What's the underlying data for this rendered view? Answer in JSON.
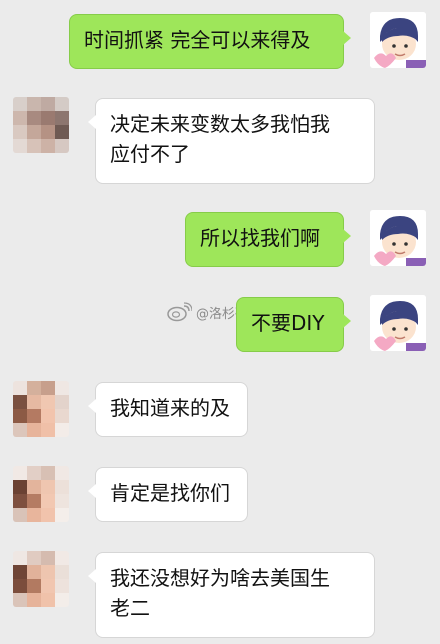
{
  "messages": [
    {
      "side": "me",
      "text": "时间抓紧 完全可以来得及"
    },
    {
      "side": "other",
      "lines": [
        "决定未来变数太多我怕我",
        "应付不了"
      ]
    },
    {
      "side": "me",
      "text": "所以找我们啊"
    },
    {
      "side": "me",
      "text": "不要DIY"
    },
    {
      "side": "other",
      "text": "我知道来的及"
    },
    {
      "side": "other",
      "text": "肯定是找你们"
    },
    {
      "side": "other",
      "lines": [
        "我还没想好为啥去美国生",
        "老二"
      ]
    }
  ],
  "watermark": {
    "text": "@洛杉矶脏爸爸"
  },
  "colors": {
    "background": "#ebebeb",
    "me_bubble": "#9ee65a",
    "other_bubble": "#ffffff"
  }
}
